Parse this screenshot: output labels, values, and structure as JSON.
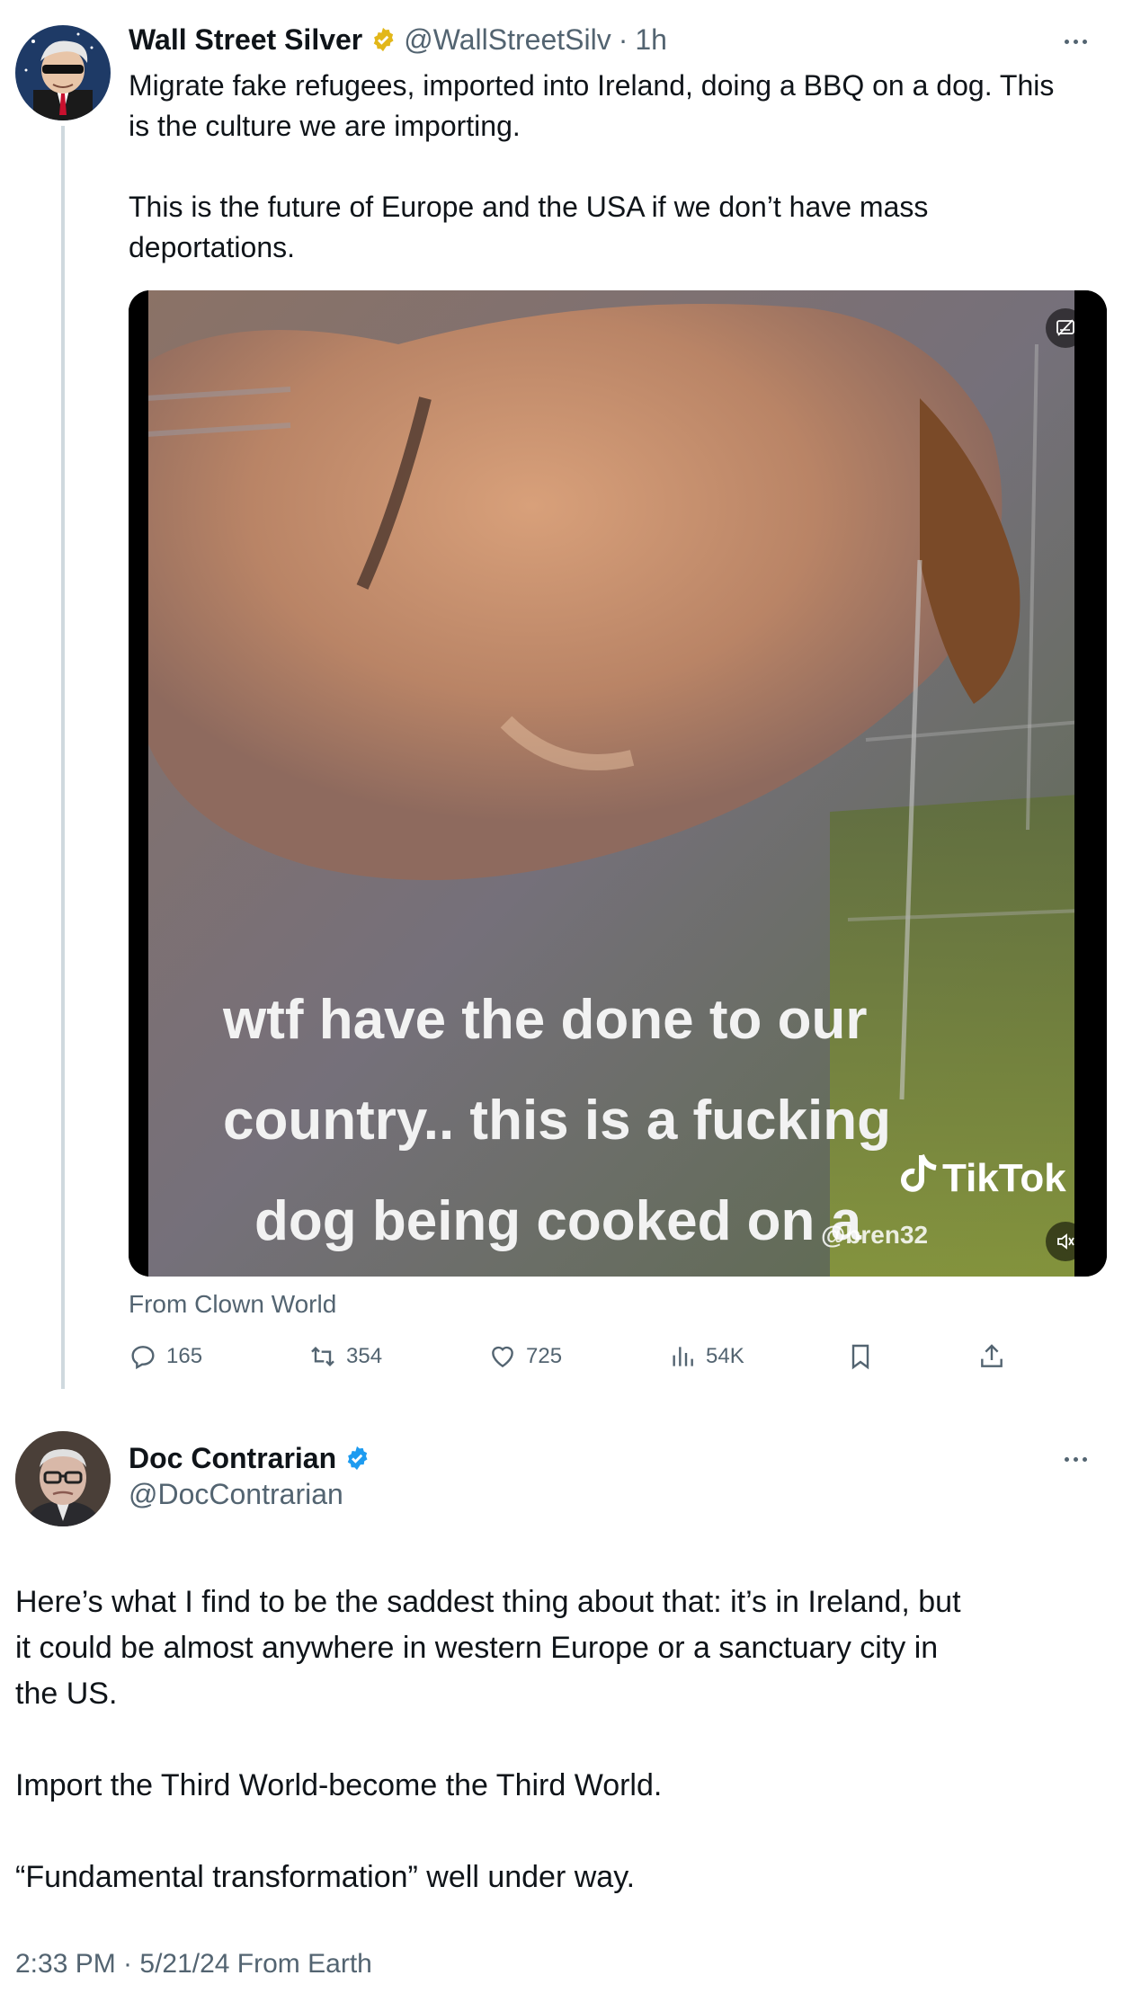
{
  "post": {
    "author": "Wall Street Silver",
    "handle": "@WallStreetSilv",
    "sep": "·",
    "time": "1h",
    "text_line1": "Migrate fake refugees, imported into Ireland, doing a BBQ on a dog. This",
    "text_line2": "is the culture we are importing.",
    "text_line3": "This is the future of Europe and the USA if we don’t have mass",
    "text_line4": "deportations.",
    "media_caption_1": "wtf have the done to our",
    "media_caption_2": "country.. this is a fucking",
    "media_caption_3": "dog being cooked on a",
    "watermark_brand": "TikTok",
    "watermark_user": "@bren32",
    "source": "From Clown World",
    "replies": "165",
    "reposts": "354",
    "likes": "725",
    "views": "54K",
    "verified_color": "#e2b719"
  },
  "reply": {
    "author": "Doc Contrarian",
    "handle": "@DocContrarian",
    "p1_line1": "Here’s what I find to be the saddest thing about that: it’s in Ireland, but",
    "p1_line2": "it could be almost anywhere in western Europe or a sanctuary city in",
    "p1_line3": "the US.",
    "p2": "Import the Third World-become the Third World.",
    "p3": "“Fundamental transformation” well under way.",
    "timestamp": "2:33 PM · 5/21/24 From Earth",
    "verified_color": "#1d9bf0"
  },
  "icons": [
    "more-icon",
    "verified-badge-icon",
    "reply-icon",
    "repost-icon",
    "like-icon",
    "views-icon",
    "bookmark-icon",
    "share-icon",
    "sensitive-content-icon",
    "volume-icon",
    "tiktok-icon"
  ]
}
